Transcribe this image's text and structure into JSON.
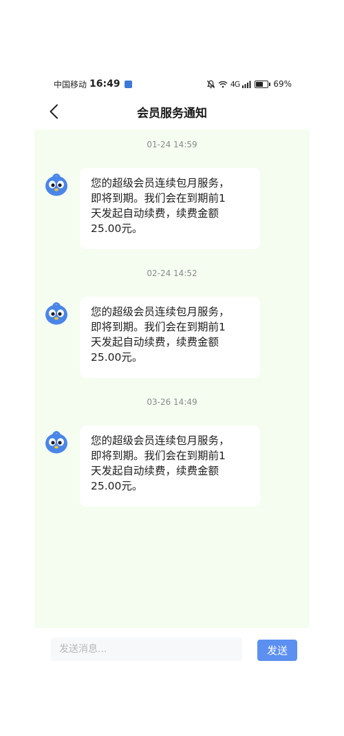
{
  "status_bar": {
    "carrier": "中国移动",
    "time": "16:49",
    "network": "4G",
    "battery": "69%"
  },
  "header": {
    "title": "会员服务通知"
  },
  "messages": [
    {
      "timestamp": "01-24 14:59",
      "lines": [
        "您的超级会员连续包月服务，",
        "即将到期。我们会在到期前1",
        "天发起自动续费，续费金额",
        "25.00元。"
      ]
    },
    {
      "timestamp": "02-24 14:52",
      "lines": [
        "您的超级会员连续包月服务，",
        "即将到期。我们会在到期前1",
        "天发起自动续费，续费金额",
        "25.00元。"
      ]
    },
    {
      "timestamp": "03-26 14:49",
      "lines": [
        "您的超级会员连续包月服务，",
        "即将到期。我们会在到期前1",
        "天发起自动续费，续费金额",
        "25.00元。"
      ]
    }
  ],
  "input": {
    "placeholder": "发送消息...",
    "send_label": "发送"
  },
  "icons": {
    "back": "chevron-left-icon",
    "avatar": "blue-bird-mascot-icon",
    "mute": "bell-off-icon",
    "wifi": "wifi-icon",
    "signal": "signal-icon",
    "battery": "battery-icon"
  },
  "colors": {
    "chat_background": "#f5fdf1",
    "send_button": "#5b8ff0",
    "avatar_blue": "#4a86e8"
  }
}
